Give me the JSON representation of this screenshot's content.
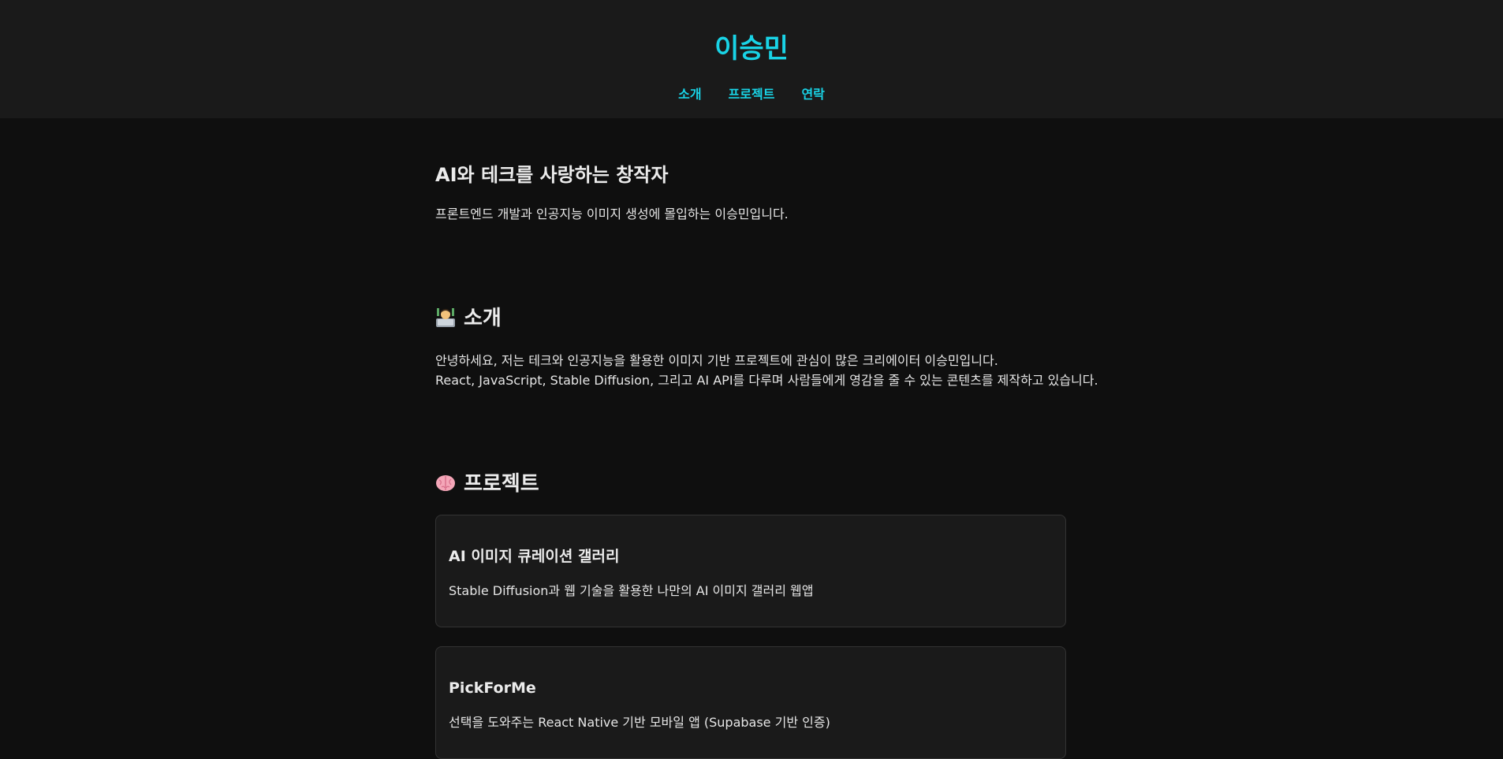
{
  "header": {
    "title": "이승민",
    "nav": [
      "소개",
      "프로젝트",
      "연락"
    ]
  },
  "hero": {
    "title": "AI와 테크를 사랑하는 창작자",
    "text": "프론트엔드 개발과 인공지능 이미지 생성에 몰입하는 이승민입니다."
  },
  "about": {
    "icon": "technologist-icon",
    "title": "소개",
    "lines": [
      "안녕하세요, 저는 테크와 인공지능을 활용한 이미지 기반 프로젝트에 관심이 많은 크리에이터 이승민입니다.",
      "React, JavaScript, Stable Diffusion, 그리고 AI API를 다루며 사람들에게 영감을 줄 수 있는 콘텐츠를 제작하고 있습니다."
    ]
  },
  "projects": {
    "icon": "brain-icon",
    "title": "프로젝트",
    "items": [
      {
        "title": "AI 이미지 큐레이션 갤러리",
        "desc": "Stable Diffusion과 웹 기술을 활용한 나만의 AI 이미지 갤러리 웹앱"
      },
      {
        "title": "PickForMe",
        "desc": "선택을 도와주는 React Native 기반 모바일 앱 (Supabase 기반 인증)"
      }
    ]
  },
  "colors": {
    "accent": "#19d3e6",
    "header_bg": "#1a1a1a",
    "page_bg": "#0f0f0f",
    "card_bg": "#1a1a1a"
  }
}
